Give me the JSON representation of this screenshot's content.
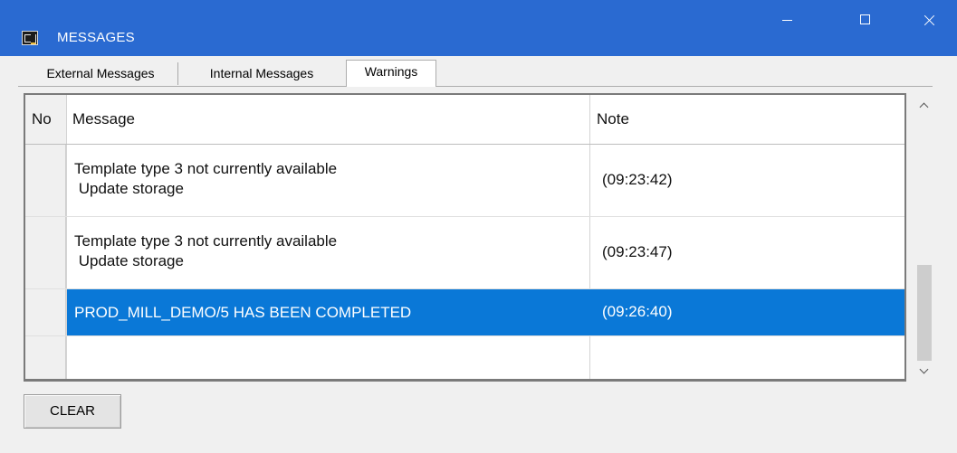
{
  "window": {
    "title": "MESSAGES",
    "icon": "app-logo-icon"
  },
  "tabs": [
    {
      "label": "External Messages",
      "active": false
    },
    {
      "label": "Internal Messages",
      "active": false
    },
    {
      "label": "Warnings",
      "active": true
    }
  ],
  "grid": {
    "headers": {
      "no": "No",
      "message": "Message",
      "note": "Note"
    },
    "rows": [
      {
        "no": "",
        "message_line1": "Template type 3 not currently available",
        "message_line2": " Update storage",
        "note": "(09:23:42)",
        "selected": false
      },
      {
        "no": "",
        "message_line1": "Template type 3 not currently available",
        "message_line2": " Update storage",
        "note": "(09:23:47)",
        "selected": false
      },
      {
        "no": "",
        "message_line1": "PROD_MILL_DEMO/5 HAS BEEN COMPLETED",
        "message_line2": "",
        "note": "(09:26:40)",
        "selected": true
      },
      {
        "no": "",
        "message_line1": "",
        "message_line2": "",
        "note": "",
        "selected": false
      }
    ]
  },
  "buttons": {
    "clear": "CLEAR"
  },
  "colors": {
    "titlebar": "#2a6ad1",
    "selection": "#0a78d7",
    "background": "#f0f0f0"
  }
}
